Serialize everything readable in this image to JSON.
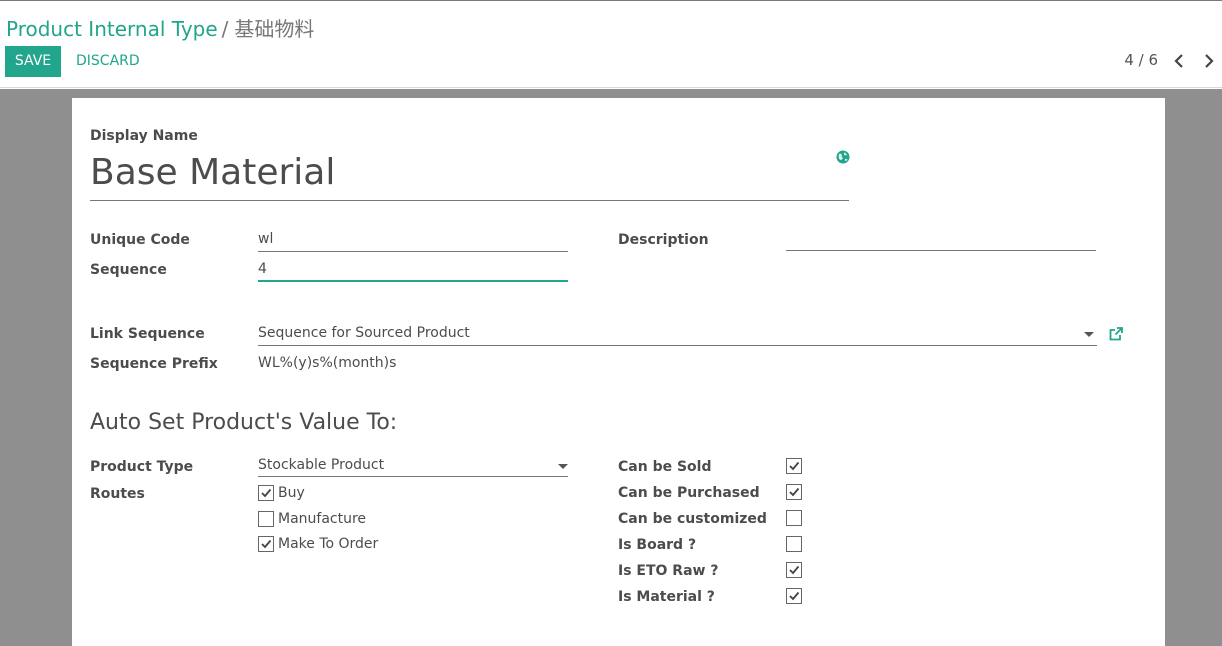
{
  "breadcrumb": {
    "parent": "Product Internal Type",
    "separator": "/",
    "current": "基础物料"
  },
  "toolbar": {
    "save_label": "SAVE",
    "discard_label": "DISCARD"
  },
  "pager": {
    "value": "4 / 6"
  },
  "form": {
    "display_name_label": "Display Name",
    "display_name_value": "Base Material",
    "unique_code_label": "Unique Code",
    "unique_code_value": "wl",
    "sequence_label": "Sequence",
    "sequence_value": "4",
    "description_label": "Description",
    "description_value": "",
    "link_sequence_label": "Link Sequence",
    "link_sequence_value": "Sequence for Sourced Product",
    "sequence_prefix_label": "Sequence Prefix",
    "sequence_prefix_value": "WL%(y)s%(month)s",
    "section_title": "Auto Set Product's Value To:",
    "product_type_label": "Product Type",
    "product_type_value": "Stockable Product",
    "routes_label": "Routes",
    "routes": [
      {
        "label": "Buy",
        "checked": true
      },
      {
        "label": "Manufacture",
        "checked": false
      },
      {
        "label": "Make To Order",
        "checked": true
      }
    ],
    "flags": [
      {
        "label": "Can be Sold",
        "checked": true
      },
      {
        "label": "Can be Purchased",
        "checked": true
      },
      {
        "label": "Can be customized",
        "checked": false
      },
      {
        "label": "Is Board ?",
        "checked": false
      },
      {
        "label": "Is ETO Raw ?",
        "checked": true
      },
      {
        "label": "Is Material ?",
        "checked": true
      }
    ]
  },
  "colors": {
    "accent": "#21a58d",
    "background": "#8f8f8f",
    "sheet": "#ffffff",
    "text": "#4c4c4c"
  },
  "icons": {
    "globe": "globe-icon",
    "external_link": "external-link-icon",
    "prev": "chevron-left-icon",
    "next": "chevron-right-icon",
    "dropdown": "caret-down-icon",
    "checkmark": "check-icon"
  }
}
